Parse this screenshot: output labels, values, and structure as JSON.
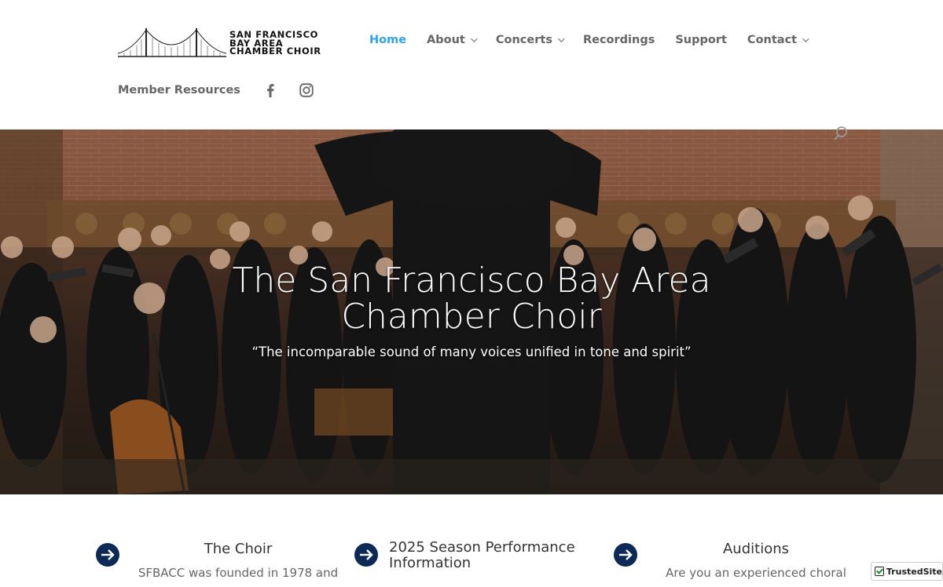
{
  "logo": {
    "lines": [
      "SAN FRANCISCO",
      "BAY AREA",
      "CHAMBER CHOIR"
    ]
  },
  "nav": {
    "items": [
      {
        "label": "Home",
        "active": true,
        "dropdown": false
      },
      {
        "label": "About",
        "active": false,
        "dropdown": true
      },
      {
        "label": "Concerts",
        "active": false,
        "dropdown": true
      },
      {
        "label": "Recordings",
        "active": false,
        "dropdown": false
      },
      {
        "label": "Support",
        "active": false,
        "dropdown": false
      },
      {
        "label": "Contact",
        "active": false,
        "dropdown": true
      }
    ],
    "member_resources": "Member Resources",
    "social_icons": [
      "facebook-icon",
      "instagram-icon"
    ],
    "search_icon": "search-icon"
  },
  "hero": {
    "title": "The San Francisco Bay Area Chamber Choir",
    "subtitle": "“The incomparable sound of many voices unified in tone and spirit”"
  },
  "blurbs": [
    {
      "title": "The Choir",
      "text": "SFBACC was founded in 1978 and"
    },
    {
      "title": "2025 Season Performance Information",
      "text": ""
    },
    {
      "title": "Auditions",
      "text": "Are you an experienced choral"
    }
  ],
  "badge": {
    "label": "TrustedSite"
  },
  "colors": {
    "accent": "#2ea3f2",
    "nav_text": "#666666",
    "arrow_bg": "#0c2a55"
  }
}
